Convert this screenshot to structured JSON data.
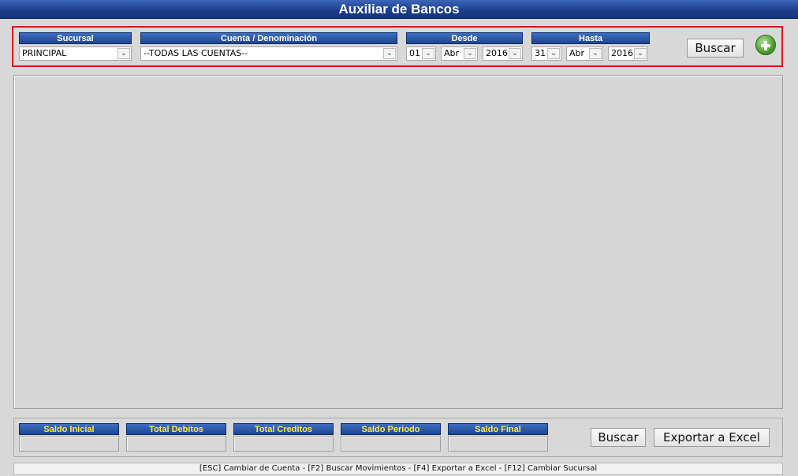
{
  "window": {
    "title": "Auxiliar de Bancos"
  },
  "filters": {
    "sucursal": {
      "label": "Sucursal",
      "value": "PRINCIPAL"
    },
    "cuenta": {
      "label": "Cuenta / Denominación",
      "value": "--TODAS LAS CUENTAS--"
    },
    "desde": {
      "label": "Desde",
      "day": "01",
      "month": "Abr",
      "year": "2016"
    },
    "hasta": {
      "label": "Hasta",
      "day": "31",
      "month": "Abr",
      "year": "2016"
    },
    "search_button": "Buscar",
    "add_icon": "plus-circle-icon"
  },
  "totals": {
    "saldo_inicial": {
      "label": "Saldo Inicial",
      "value": ""
    },
    "total_debitos": {
      "label": "Total Debitos",
      "value": ""
    },
    "total_creditos": {
      "label": "Total Creditos",
      "value": ""
    },
    "saldo_periodo": {
      "label": "Saldo Periodo",
      "value": ""
    },
    "saldo_final": {
      "label": "Saldo Final",
      "value": ""
    }
  },
  "actions": {
    "search": "Buscar",
    "export": "Exportar a Excel"
  },
  "status": {
    "shortcuts": "[ESC] Cambiar de Cuenta   -   [F2] Buscar Movimientos   -   [F4] Exportar a Excel   -   [F12] Cambiar Sucursal"
  },
  "colors": {
    "header_blue": "#1d4690",
    "panel_border": "#e0141a",
    "total_label": "#ffe94a"
  }
}
